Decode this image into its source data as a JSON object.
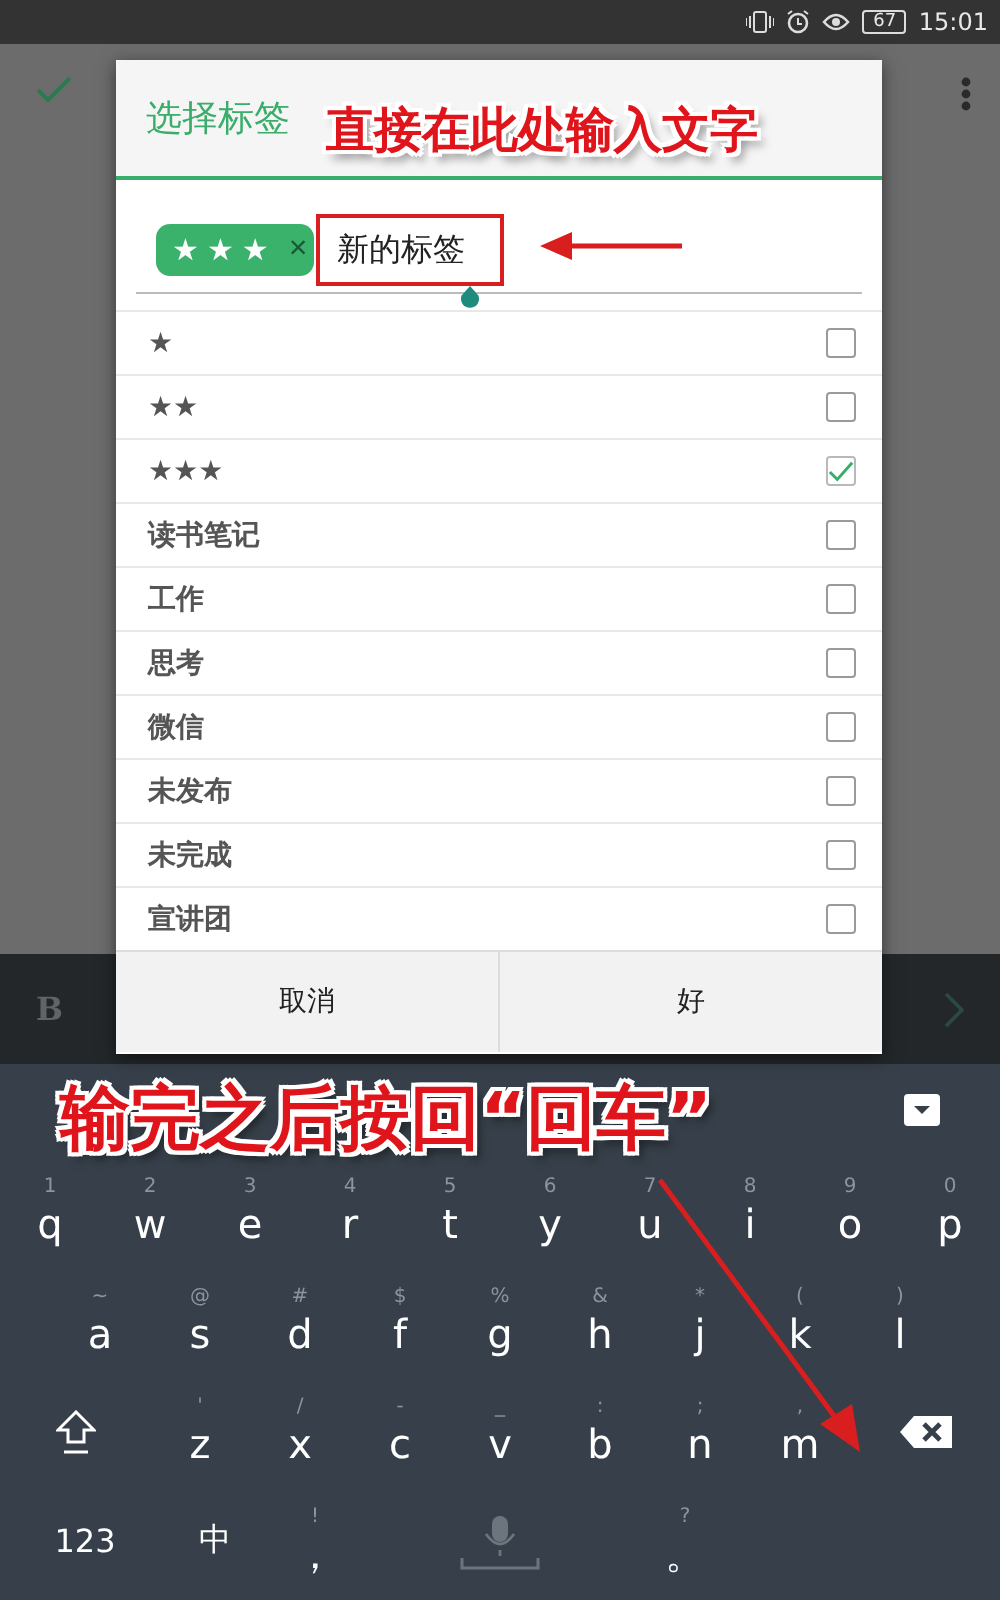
{
  "status_bar": {
    "battery": "67",
    "time": "15:01"
  },
  "dialog": {
    "title": "选择标签",
    "chips": [
      {
        "label": "★★★",
        "remove": "×"
      }
    ],
    "input": {
      "value": "新的标签"
    },
    "tags": [
      {
        "label": "★",
        "checked": false
      },
      {
        "label": "★★",
        "checked": false
      },
      {
        "label": "★★★",
        "checked": true
      },
      {
        "label": "读书笔记",
        "checked": false
      },
      {
        "label": "工作",
        "checked": false
      },
      {
        "label": "思考",
        "checked": false
      },
      {
        "label": "微信",
        "checked": false
      },
      {
        "label": "未发布",
        "checked": false
      },
      {
        "label": "未完成",
        "checked": false
      },
      {
        "label": "宣讲团",
        "checked": false
      }
    ],
    "buttons": [
      "取消",
      "好"
    ]
  },
  "editor_toolbar": {
    "bold": "B"
  },
  "keyboard": {
    "rows": [
      [
        {
          "kind": "char",
          "key": "q",
          "hint": "1"
        },
        {
          "kind": "char",
          "key": "w",
          "hint": "2"
        },
        {
          "kind": "char",
          "key": "e",
          "hint": "3"
        },
        {
          "kind": "char",
          "key": "r",
          "hint": "4"
        },
        {
          "kind": "char",
          "key": "t",
          "hint": "5"
        },
        {
          "kind": "char",
          "key": "y",
          "hint": "6"
        },
        {
          "kind": "char",
          "key": "u",
          "hint": "7"
        },
        {
          "kind": "char",
          "key": "i",
          "hint": "8"
        },
        {
          "kind": "char",
          "key": "o",
          "hint": "9"
        },
        {
          "kind": "char",
          "key": "p",
          "hint": "0"
        }
      ],
      [
        {
          "kind": "char",
          "key": "a",
          "hint": "~"
        },
        {
          "kind": "char",
          "key": "s",
          "hint": "@"
        },
        {
          "kind": "char",
          "key": "d",
          "hint": "#"
        },
        {
          "kind": "char",
          "key": "f",
          "hint": "$"
        },
        {
          "kind": "char",
          "key": "g",
          "hint": "%"
        },
        {
          "kind": "char",
          "key": "h",
          "hint": "&"
        },
        {
          "kind": "char",
          "key": "j",
          "hint": "*"
        },
        {
          "kind": "char",
          "key": "k",
          "hint": "("
        },
        {
          "kind": "char",
          "key": "l",
          "hint": ")"
        }
      ],
      [
        {
          "kind": "shift"
        },
        {
          "kind": "char",
          "key": "z",
          "hint": "'"
        },
        {
          "kind": "char",
          "key": "x",
          "hint": "/"
        },
        {
          "kind": "char",
          "key": "c",
          "hint": "-"
        },
        {
          "kind": "char",
          "key": "v",
          "hint": "_"
        },
        {
          "kind": "char",
          "key": "b",
          "hint": ":"
        },
        {
          "kind": "char",
          "key": "n",
          "hint": ";"
        },
        {
          "kind": "char",
          "key": "m",
          "hint": ","
        },
        {
          "kind": "backspace"
        }
      ],
      [
        {
          "kind": "text",
          "key": "123"
        },
        {
          "kind": "text",
          "key": "中"
        },
        {
          "kind": "char",
          "key": "，",
          "hint": "!"
        },
        {
          "kind": "space"
        },
        {
          "kind": "char",
          "key": "。",
          "hint": "?"
        }
      ]
    ]
  },
  "annotations": [
    {
      "text": "直接在此处输入文字"
    },
    {
      "text": "输完之后按回“回车”"
    }
  ]
}
